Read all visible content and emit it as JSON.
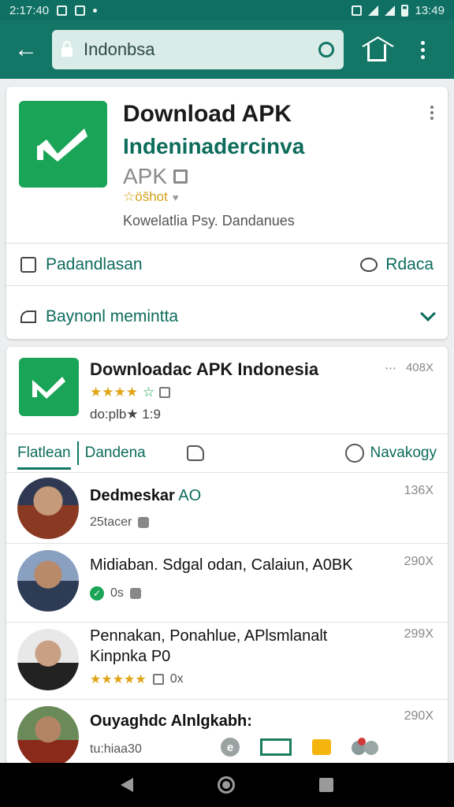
{
  "status_bar": {
    "time": "2:17:40",
    "clock_right": "13:49"
  },
  "app_bar": {
    "url": "Indonbsa"
  },
  "top_card": {
    "title": "Download APK",
    "subtitle": "Indeninadercinva",
    "apk_label": "APK",
    "rating_text": "☆öšhot",
    "meta": "Kowelatlia Psy. Dandanues",
    "action_left": "Padandlasan",
    "action_right": "Rdaca",
    "expand_label": "Baynonl memintta"
  },
  "second_card": {
    "title": "Downloadac APK Indonesia",
    "count": "408X",
    "meta": "do:plb★ 1:9",
    "stars": "★★★★",
    "tabs": {
      "t1": "Flatlean",
      "t2": "Dandena",
      "t4": "Navakogy"
    },
    "posts": [
      {
        "name": "Dedmeskar",
        "name_accent": "AO",
        "count": "136X",
        "sub": "25tacer"
      },
      {
        "name": "Midiaban. Sdgal odan, Calaiun, A0BK",
        "count": "290X",
        "sub": "0s"
      },
      {
        "name_line1": "Pennakan, Ponahlue, APlsmlanalt",
        "name_line2": "Kinpnka P0",
        "count": "299X",
        "stars": "★★★★★",
        "sub": "0x"
      },
      {
        "name": "Ouyaghdc Alnlgkabh:",
        "count": "290X",
        "sub": "tu:hiaa30"
      }
    ],
    "dock_e": "e"
  }
}
